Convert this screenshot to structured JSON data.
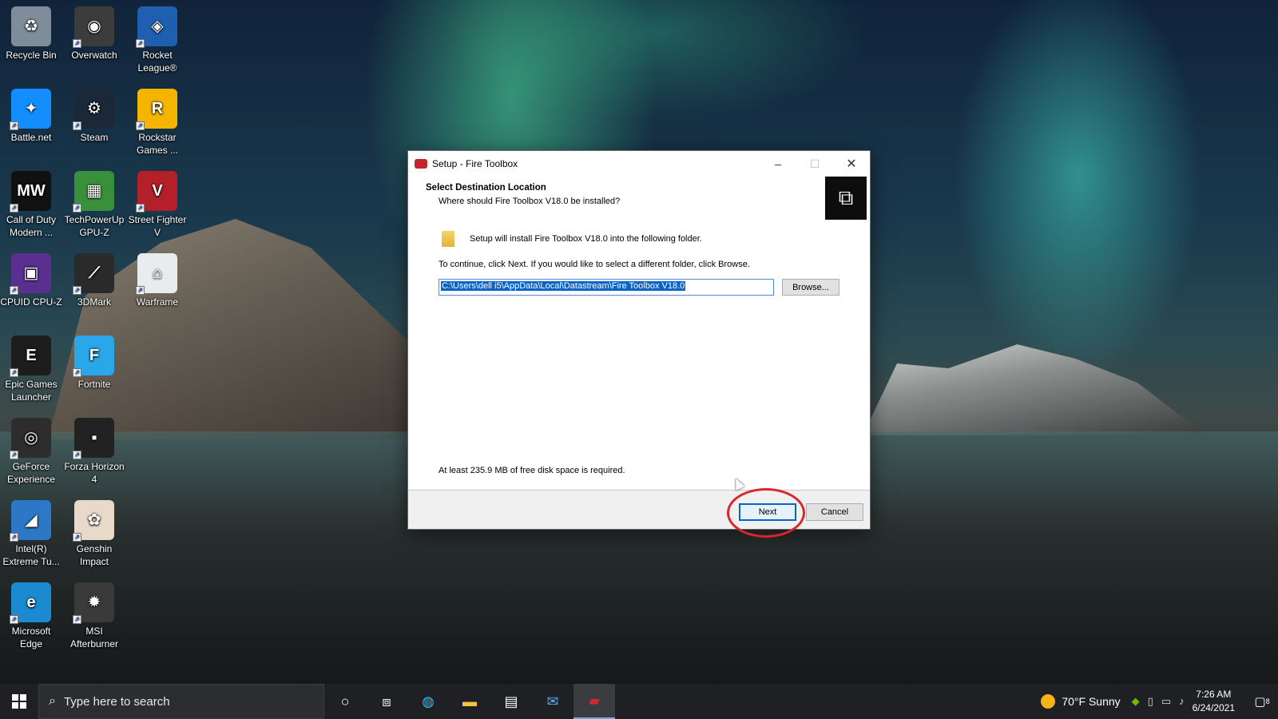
{
  "desktop": {
    "icons": [
      {
        "label": "Recycle Bin",
        "icon": "recycle-bin-icon",
        "color": "#7f8c99"
      },
      {
        "label": "Overwatch",
        "icon": "overwatch-icon",
        "color": "#3c3c3c"
      },
      {
        "label": "Rocket League®",
        "icon": "rocket-league-icon",
        "color": "#1f5fb0"
      },
      {
        "label": "Battle.net",
        "icon": "battlenet-icon",
        "color": "#148eff"
      },
      {
        "label": "Steam",
        "icon": "steam-icon",
        "color": "#1b2838"
      },
      {
        "label": "Rockstar Games ...",
        "icon": "rockstar-icon",
        "color": "#f5b400"
      },
      {
        "label": "Call of Duty Modern ...",
        "icon": "call-of-duty-icon",
        "color": "#111111"
      },
      {
        "label": "TechPowerUp GPU-Z",
        "icon": "gpuz-icon",
        "color": "#3a8f3a"
      },
      {
        "label": "Street Fighter V",
        "icon": "street-fighter-icon",
        "color": "#b3202a"
      },
      {
        "label": "CPUID CPU-Z",
        "icon": "cpuz-icon",
        "color": "#5b2f8f"
      },
      {
        "label": "3DMark",
        "icon": "3dmark-icon",
        "color": "#2a2a2a"
      },
      {
        "label": "Warframe",
        "icon": "warframe-icon",
        "color": "#e8ecef"
      },
      {
        "label": "Epic Games Launcher",
        "icon": "epic-games-icon",
        "color": "#1d1d1d"
      },
      {
        "label": "Fortnite",
        "icon": "fortnite-icon",
        "color": "#2aa7e8"
      },
      {
        "label": "GeForce Experience",
        "icon": "geforce-icon",
        "color": "#2d2d2d"
      },
      {
        "label": "Forza Horizon 4",
        "icon": "forza-icon",
        "color": "#222222"
      },
      {
        "label": "Intel(R) Extreme Tu...",
        "icon": "intel-xtu-icon",
        "color": "#2c78c6"
      },
      {
        "label": "Genshin Impact",
        "icon": "genshin-icon",
        "color": "#e9d9c8"
      },
      {
        "label": "Microsoft Edge",
        "icon": "edge-icon",
        "color": "#1b8ad0"
      },
      {
        "label": "MSI Afterburner",
        "icon": "msi-afterburner-icon",
        "color": "#3a3a3a"
      }
    ],
    "icon_glyphs": {
      "Recycle Bin": "♻",
      "Overwatch": "◉",
      "Rocket League®": "◈",
      "Battle.net": "✦",
      "Steam": "⚙",
      "Rockstar Games ...": "R",
      "Call of Duty Modern ...": "MW",
      "TechPowerUp GPU-Z": "▦",
      "Street Fighter V": "V",
      "CPUID CPU-Z": "▣",
      "3DMark": "⟋",
      "Warframe": "⌂",
      "Epic Games Launcher": "E",
      "Fortnite": "F",
      "GeForce Experience": "◎",
      "Forza Horizon 4": "▪",
      "Intel(R) Extreme Tu...": "◢",
      "Genshin Impact": "✿",
      "Microsoft Edge": "e",
      "MSI Afterburner": "✹"
    }
  },
  "window": {
    "title": "Setup - Fire Toolbox",
    "minimize_glyph": "–",
    "maximize_glyph": "☐",
    "close_glyph": "✕",
    "header_title": "Select Destination Location",
    "header_subtitle": "Where should Fire Toolbox V18.0 be installed?",
    "install_info": "Setup will install Fire Toolbox V18.0 into the following folder.",
    "continue_info": "To continue, click Next. If you would like to select a different folder, click Browse.",
    "path_value": "C:\\Users\\dell i5\\AppData\\Local\\Datastream\\Fire Toolbox V18.0",
    "browse_label": "Browse...",
    "disk_space": "At least 235.9 MB of free disk space is required.",
    "next_label": "Next",
    "cancel_label": "Cancel",
    "highlight_color": "#d9262c"
  },
  "taskbar": {
    "search_placeholder": "Type here to search",
    "weather_temp": "70°F",
    "weather_text": "Sunny",
    "time": "7:26 AM",
    "date": "6/24/2021",
    "notification_count": "8"
  }
}
